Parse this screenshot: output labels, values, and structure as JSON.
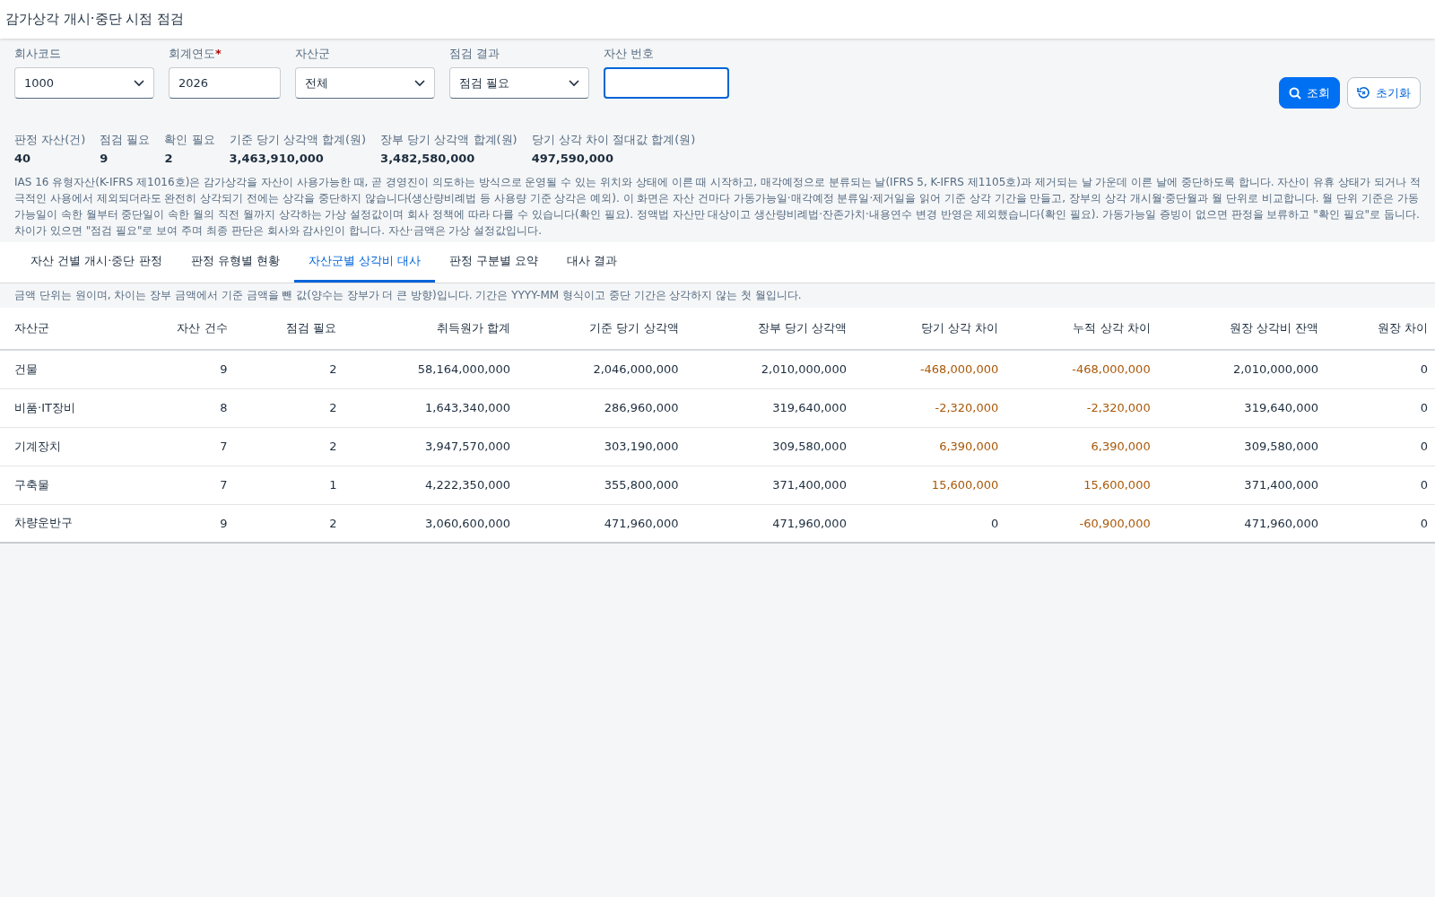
{
  "window": {
    "title": "감가상각 개시·중단 시점 점검"
  },
  "filters": [
    {
      "kind": "select",
      "label": "회사코드",
      "value": "1000"
    },
    {
      "kind": "text",
      "label": "회계연도",
      "required_mark": "*",
      "value": "2026"
    },
    {
      "kind": "select",
      "label": "자산군",
      "value": "전체"
    },
    {
      "kind": "select",
      "label": "점검 결과",
      "value": "점검 필요"
    },
    {
      "kind": "text",
      "label": "자산 번호",
      "focused": true
    }
  ],
  "buttons": [
    {
      "kind": "primary",
      "label": "조회"
    },
    {
      "kind": "secondary",
      "label": "초기화"
    }
  ],
  "summary": [
    {
      "label": "판정 자산(건)",
      "value": "40"
    },
    {
      "label": "점검 필요",
      "value": "9"
    },
    {
      "label": "확인 필요",
      "value": "2"
    },
    {
      "label": "기준 당기 상각액 합계(원)",
      "value": "3,463,910,000"
    },
    {
      "label": "장부 당기 상각액 합계(원)",
      "value": "3,482,580,000"
    },
    {
      "label": "당기 상각 차이 절대값 합계(원)",
      "value": "497,590,000"
    }
  ],
  "description": "IAS 16 유형자산(K-IFRS 제1016호)은 감가상각을 자산이 사용가능한 때, 곧 경영진이 의도하는 방식으로 운영될 수 있는 위치와 상태에 이른 때 시작하고, 매각예정으로 분류되는 날(IFRS 5, K-IFRS 제1105호)과 제거되는 날 가운데 이른 날에 중단하도록 합니다. 자산이 유휴 상태가 되거나 적극적인 사용에서 제외되더라도 완전히 상각되기 전에는 상각을 중단하지 않습니다(생산량비례법 등 사용량 기준 상각은 예외). 이 화면은 자산 건마다 가동가능일·매각예정 분류일·제거일을 읽어 기준 상각 기간을 만들고, 장부의 상각 개시월·중단월과 월 단위로 비교합니다. 월 단위 기준은 가동가능일이 속한 월부터 중단일이 속한 월의 직전 월까지 상각하는 가상 설정값이며 회사 정책에 따라 다를 수 있습니다(확인 필요). 정액법 자산만 대상이고 생산량비례법·잔존가치·내용연수 변경 반영은 제외했습니다(확인 필요). 가동가능일 증빙이 없으면 판정을 보류하고 \"확인 필요\"로 둡니다. 차이가 있으면 \"점검 필요\"로 보여 주며 최종 판단은 회사와 감사인이 합니다. 자산·금액은 가상 설정값입니다.",
  "tabs": [
    {
      "label": "자산 건별 개시·중단 판정",
      "selected": false
    },
    {
      "label": "판정 유형별 현황",
      "selected": false
    },
    {
      "label": "자산군별 상각비 대사",
      "selected": true
    },
    {
      "label": "판정 구분별 요약",
      "selected": false
    },
    {
      "label": "대사 결과",
      "selected": false
    }
  ],
  "note": "금액 단위는 원이며, 차이는 장부 금액에서 기준 금액을 뺀 값(양수는 장부가 더 큰 방향)입니다. 기간은 YYYY-MM 형식이고 중단 기간은 상각하지 않는 첫 월입니다.",
  "table": {
    "columns": [
      "자산군",
      "자산 건수",
      "점검 필요",
      "취득원가 합계",
      "기준 당기 상각액",
      "장부 당기 상각액",
      "당기 상각 차이",
      "누적 상각 차이",
      "원장 상각비 잔액",
      "원장 차이"
    ],
    "rows": [
      {
        "cells": [
          {
            "text": "건물",
            "warn": false
          },
          {
            "text": "9",
            "warn": false
          },
          {
            "text": "2",
            "warn": false
          },
          {
            "text": "58,164,000,000",
            "warn": false
          },
          {
            "text": "2,046,000,000",
            "warn": false
          },
          {
            "text": "2,010,000,000",
            "warn": false
          },
          {
            "text": "-468,000,000",
            "warn": true
          },
          {
            "text": "-468,000,000",
            "warn": true
          },
          {
            "text": "2,010,000,000",
            "warn": false
          },
          {
            "text": "0",
            "warn": false
          }
        ]
      },
      {
        "cells": [
          {
            "text": "비품·IT장비",
            "warn": false
          },
          {
            "text": "8",
            "warn": false
          },
          {
            "text": "2",
            "warn": false
          },
          {
            "text": "1,643,340,000",
            "warn": false
          },
          {
            "text": "286,960,000",
            "warn": false
          },
          {
            "text": "319,640,000",
            "warn": false
          },
          {
            "text": "-2,320,000",
            "warn": true
          },
          {
            "text": "-2,320,000",
            "warn": true
          },
          {
            "text": "319,640,000",
            "warn": false
          },
          {
            "text": "0",
            "warn": false
          }
        ]
      },
      {
        "cells": [
          {
            "text": "기계장치",
            "warn": false
          },
          {
            "text": "7",
            "warn": false
          },
          {
            "text": "2",
            "warn": false
          },
          {
            "text": "3,947,570,000",
            "warn": false
          },
          {
            "text": "303,190,000",
            "warn": false
          },
          {
            "text": "309,580,000",
            "warn": false
          },
          {
            "text": "6,390,000",
            "warn": true
          },
          {
            "text": "6,390,000",
            "warn": true
          },
          {
            "text": "309,580,000",
            "warn": false
          },
          {
            "text": "0",
            "warn": false
          }
        ]
      },
      {
        "cells": [
          {
            "text": "구축물",
            "warn": false
          },
          {
            "text": "7",
            "warn": false
          },
          {
            "text": "1",
            "warn": false
          },
          {
            "text": "4,222,350,000",
            "warn": false
          },
          {
            "text": "355,800,000",
            "warn": false
          },
          {
            "text": "371,400,000",
            "warn": false
          },
          {
            "text": "15,600,000",
            "warn": true
          },
          {
            "text": "15,600,000",
            "warn": true
          },
          {
            "text": "371,400,000",
            "warn": false
          },
          {
            "text": "0",
            "warn": false
          }
        ]
      },
      {
        "cells": [
          {
            "text": "차량운반구",
            "warn": false
          },
          {
            "text": "9",
            "warn": false
          },
          {
            "text": "2",
            "warn": false
          },
          {
            "text": "3,060,600,000",
            "warn": false
          },
          {
            "text": "471,960,000",
            "warn": false
          },
          {
            "text": "471,960,000",
            "warn": false
          },
          {
            "text": "0",
            "warn": false
          },
          {
            "text": "-60,900,000",
            "warn": true
          },
          {
            "text": "471,960,000",
            "warn": false
          },
          {
            "text": "0",
            "warn": false
          }
        ]
      }
    ]
  }
}
